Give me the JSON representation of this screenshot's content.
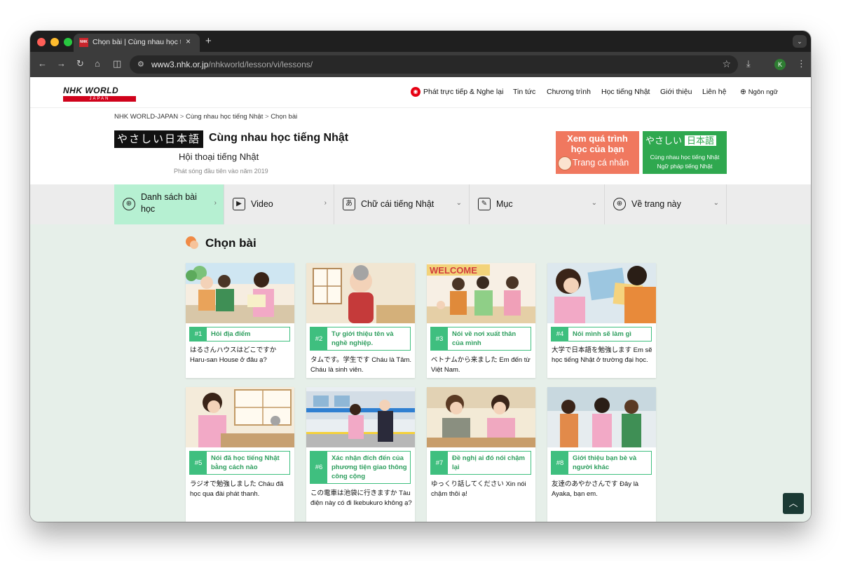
{
  "browser": {
    "tab_title": "Chọn bài | Cùng nhau học tiếng Nhật",
    "favicon_text": "NHK",
    "close_glyph": "×",
    "new_tab_glyph": "+",
    "menu_glyph": "⌄",
    "url_host": "www3.nhk.or.jp",
    "url_path": "/nhkworld/lesson/vi/lessons/",
    "profile_initial": "K"
  },
  "header": {
    "logo_top": "NHK WORLD",
    "logo_bottom": "JAPAN",
    "nav": {
      "live": "Phát trực tiếp & Nghe lại",
      "news": "Tin tức",
      "programs": "Chương trình",
      "learn": "Học tiếng Nhật",
      "about": "Giới thiệu",
      "contact": "Liên hệ",
      "language": "Ngôn ngữ"
    }
  },
  "breadcrumb": [
    "NHK WORLD-JAPAN",
    "Cùng nhau học tiếng Nhật",
    "Chọn bài"
  ],
  "brand": {
    "jp_badge": "やさしい日本語",
    "title": "Cùng nhau học tiếng Nhật",
    "subtitle": "Hội thoại tiếng Nhật",
    "first_aired": "Phát sóng đầu tiên vào năm 2019"
  },
  "banners": {
    "progress_line1": "Xem quá trình",
    "progress_line2": "học của bạn",
    "progress_link": "Trang cá nhân",
    "easy_jp_kana": "やさしい",
    "easy_jp_kanji": "日本語",
    "easy_jp_line1": "Cùng nhau học tiếng Nhật",
    "easy_jp_line2": "Ngữ pháp tiếng Nhật"
  },
  "tabs": [
    {
      "label_1": "Danh sách bài",
      "label_2": "học",
      "icon": "⊕"
    },
    {
      "label": "Video",
      "icon": "▶"
    },
    {
      "label": "Chữ cái tiếng Nhật",
      "icon": "あ"
    },
    {
      "label": "Mục",
      "icon": "✎"
    },
    {
      "label": "Về trang này",
      "icon": "⊕"
    }
  ],
  "section_title": "Chọn bài",
  "lessons": [
    {
      "num": "#1",
      "topic": "Hỏi địa điểm",
      "text": "はるさんハウスはどこですか Haru-san House ở đâu ạ?"
    },
    {
      "num": "#2",
      "topic": "Tự giới thiệu tên và nghề nghiệp.",
      "text": "タムです。学生です Cháu là Tâm. Cháu là sinh viên."
    },
    {
      "num": "#3",
      "topic": "Nói về nơi xuất thân của mình",
      "text": "ベトナムから来ました Em đến từ Việt Nam."
    },
    {
      "num": "#4",
      "topic": "Nói mình sẽ làm gì",
      "text": "大学で日本語を勉強します Em sẽ học tiếng Nhật ở trường đại học."
    },
    {
      "num": "#5",
      "topic": "Nói đã học tiếng Nhật bằng cách nào",
      "text": "ラジオで勉強しました Cháu đã học qua đài phát thanh."
    },
    {
      "num": "#6",
      "topic": "Xác nhận đích đến của phương tiện giao thông công cộng",
      "text": "この電車は池袋に行きますか Tàu điện này có đi Ikebukuro không ạ?"
    },
    {
      "num": "#7",
      "topic": "Đề nghị ai đó nói chậm lại",
      "text": "ゆっくり話してください Xin nói chậm thôi ạ!"
    },
    {
      "num": "#8",
      "topic": "Giới thiệu bạn bè và người khác",
      "text": "友達のあやかさんです Đây là Ayaka, bạn em."
    }
  ],
  "scene_texts": {
    "welcome_sign": "WELCOME"
  },
  "back_to_top_glyph": "︿"
}
